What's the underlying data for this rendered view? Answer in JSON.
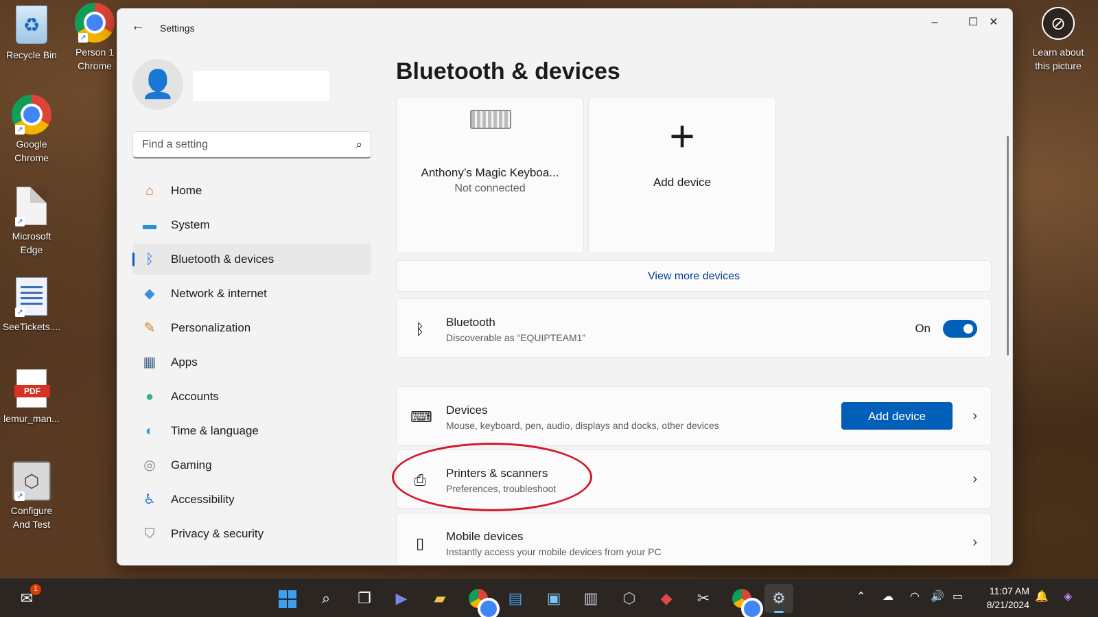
{
  "desktop": {
    "icons": [
      {
        "label": "Recycle Bin",
        "icon": "recycle-bin-icon"
      },
      {
        "label": "Person 1 Chrome",
        "label_l1": "Person 1",
        "label_l2": "Chrome",
        "icon": "chrome-profile-icon"
      },
      {
        "label": "Google Chrome",
        "label_l1": "Google",
        "label_l2": "Chrome",
        "icon": "chrome-icon"
      },
      {
        "label": "Microsoft Edge",
        "label_l1": "Microsoft",
        "label_l2": "Edge",
        "icon": "edge-shortcut-icon"
      },
      {
        "label": "SeeTickets....",
        "icon": "document-icon"
      },
      {
        "label": "lemur_man...",
        "icon": "pdf-icon",
        "badge": "PDF"
      },
      {
        "label": "Configure And Test",
        "label_l1": "Configure",
        "label_l2": "And Test",
        "icon": "configure-icon"
      }
    ],
    "learn_picture": {
      "line1": "Learn about",
      "line2": "this picture"
    }
  },
  "window": {
    "title": "Settings",
    "controls": {
      "minimize": "–",
      "maximize": "☐",
      "close": "✕"
    },
    "search": {
      "placeholder": "Find a setting"
    },
    "nav": [
      {
        "label": "Home",
        "icon": "home-icon",
        "glyph": "⌂",
        "color": "#e8744f"
      },
      {
        "label": "System",
        "icon": "system-icon",
        "glyph": "▬",
        "color": "#2c8fd6"
      },
      {
        "label": "Bluetooth & devices",
        "icon": "bluetooth-icon",
        "glyph": "ᛒ",
        "color": "#1f76d2",
        "active": true
      },
      {
        "label": "Network & internet",
        "icon": "wifi-icon",
        "glyph": "◆",
        "color": "#3a8fe0"
      },
      {
        "label": "Personalization",
        "icon": "brush-icon",
        "glyph": "✎",
        "color": "#d4781c"
      },
      {
        "label": "Apps",
        "icon": "apps-icon",
        "glyph": "▦",
        "color": "#4a6a8a"
      },
      {
        "label": "Accounts",
        "icon": "accounts-icon",
        "glyph": "●",
        "color": "#3bb27c"
      },
      {
        "label": "Time & language",
        "icon": "globe-clock-icon",
        "glyph": "◐",
        "color": "#2a9fd6"
      },
      {
        "label": "Gaming",
        "icon": "gamepad-icon",
        "glyph": "◎",
        "color": "#7a8694"
      },
      {
        "label": "Accessibility",
        "icon": "accessibility-icon",
        "glyph": "♿",
        "color": "#1f76d2"
      },
      {
        "label": "Privacy & security",
        "icon": "shield-icon",
        "glyph": "⛉",
        "color": "#6f7b87"
      }
    ]
  },
  "content": {
    "page_title": "Bluetooth & devices",
    "device_tiles": [
      {
        "name": "Anthony’s Magic Keyboa...",
        "status": "Not connected",
        "icon": "keyboard-icon"
      },
      {
        "name": "Add device",
        "icon": "plus-icon"
      }
    ],
    "view_more": "View more devices",
    "bluetooth": {
      "title": "Bluetooth",
      "subtitle": "Discoverable as “EQUIPTEAM1”",
      "state": "On",
      "enabled": true
    },
    "rows": [
      {
        "title": "Devices",
        "subtitle": "Mouse, keyboard, pen, audio, displays and docks, other devices",
        "button": "Add device",
        "icon": "devices-icon"
      },
      {
        "title": "Printers & scanners",
        "subtitle": "Preferences, troubleshoot",
        "icon": "printer-icon",
        "highlighted": true
      },
      {
        "title": "Mobile devices",
        "subtitle": "Instantly access your mobile devices from your PC",
        "icon": "phone-icon"
      }
    ],
    "annotation_color": "#d21a2a"
  },
  "taskbar": {
    "notification_badge": "1",
    "apps": [
      "start",
      "search",
      "task-view",
      "meet",
      "file-explorer",
      "chrome",
      "notepad",
      "photos",
      "document",
      "configure",
      "pen-tool",
      "snipping-tool",
      "chrome-profile",
      "settings"
    ],
    "clock": {
      "time": "11:07 AM",
      "date": "8/21/2024"
    }
  }
}
